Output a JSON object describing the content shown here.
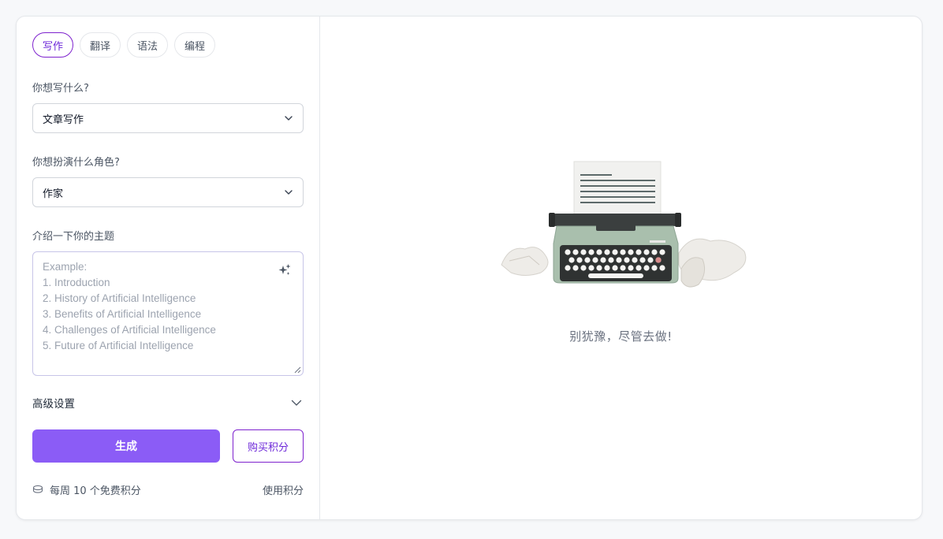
{
  "tabs": [
    {
      "label": "写作",
      "active": true
    },
    {
      "label": "翻译",
      "active": false
    },
    {
      "label": "语法",
      "active": false
    },
    {
      "label": "编程",
      "active": false
    }
  ],
  "form": {
    "write_label": "你想写什么?",
    "write_value": "文章写作",
    "role_label": "你想扮演什么角色?",
    "role_value": "作家",
    "topic_label": "介绍一下你的主题",
    "topic_placeholder_lines": [
      "Example:",
      "1. Introduction",
      "2. History of Artificial Intelligence",
      "3. Benefits of Artificial Intelligence",
      "4. Challenges of Artificial Intelligence",
      "5. Future of Artificial Intelligence"
    ],
    "advanced_label": "高级设置"
  },
  "actions": {
    "generate_label": "生成",
    "buy_label": "购买积分"
  },
  "footer": {
    "free_credits": "每周 10 个免费积分",
    "use_credits": "使用积分"
  },
  "empty_state": {
    "tagline": "别犹豫，尽管去做!"
  },
  "colors": {
    "accent": "#8b5cf6",
    "accent_dark": "#7e22ce"
  }
}
